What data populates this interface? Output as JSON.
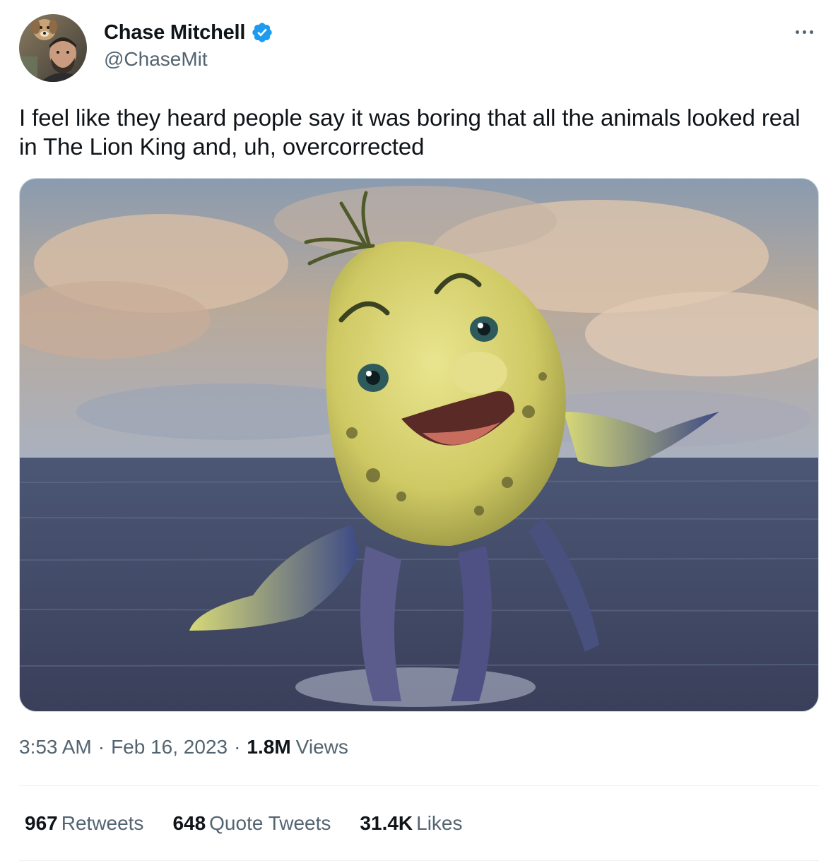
{
  "author": {
    "display_name": "Chase Mitchell",
    "handle": "@ChaseMit",
    "verified": true,
    "verified_color": "#1d9bf0",
    "avatar_icon": "profile-photo-with-dog"
  },
  "menu_icon": "more-horizontal-icon",
  "tweet": {
    "text": "I feel like they heard people say it was boring that all the animals looked real in The Lion King and, uh, overcorrected"
  },
  "media": {
    "type": "photo",
    "icon": "photorealistic-cartoon-fish-jumping-from-ocean"
  },
  "meta": {
    "time": "3:53 AM",
    "separator": "·",
    "date": "Feb 16, 2023",
    "views_count": "1.8M",
    "views_label": "Views"
  },
  "stats": {
    "retweets": {
      "count": "967",
      "label": "Retweets"
    },
    "quote_tweets": {
      "count": "648",
      "label": "Quote Tweets"
    },
    "likes": {
      "count": "31.4K",
      "label": "Likes"
    }
  },
  "colors": {
    "text_primary": "#0f1419",
    "text_secondary": "#536471",
    "divider": "#eff3f4"
  }
}
